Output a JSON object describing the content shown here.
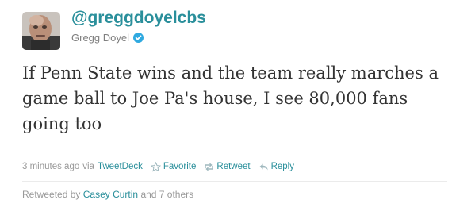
{
  "tweet": {
    "handle": "@greggdoyelcbs",
    "display_name": "Gregg Doyel",
    "verified": true,
    "text": "If Penn State wins and the team really marches a game ball to Joe Pa's house, I see 80,000 fans going too",
    "timestamp": "3 minutes ago",
    "via_label": "via",
    "source": "TweetDeck",
    "actions": {
      "favorite": "Favorite",
      "retweet": "Retweet",
      "reply": "Reply"
    },
    "retweeted_by": {
      "label": "Retweeted by",
      "names": "Casey Curtin",
      "suffix": "and 7 others"
    }
  },
  "colors": {
    "link": "#2a8f9b",
    "text": "#333333",
    "muted": "#999999",
    "verified_badge": "#2fa9e0"
  },
  "icons": {
    "avatar": "avatar-photo",
    "verified": "verified-badge-icon",
    "favorite": "star-icon",
    "retweet": "retweet-arrows-icon",
    "reply": "reply-arrow-icon"
  }
}
